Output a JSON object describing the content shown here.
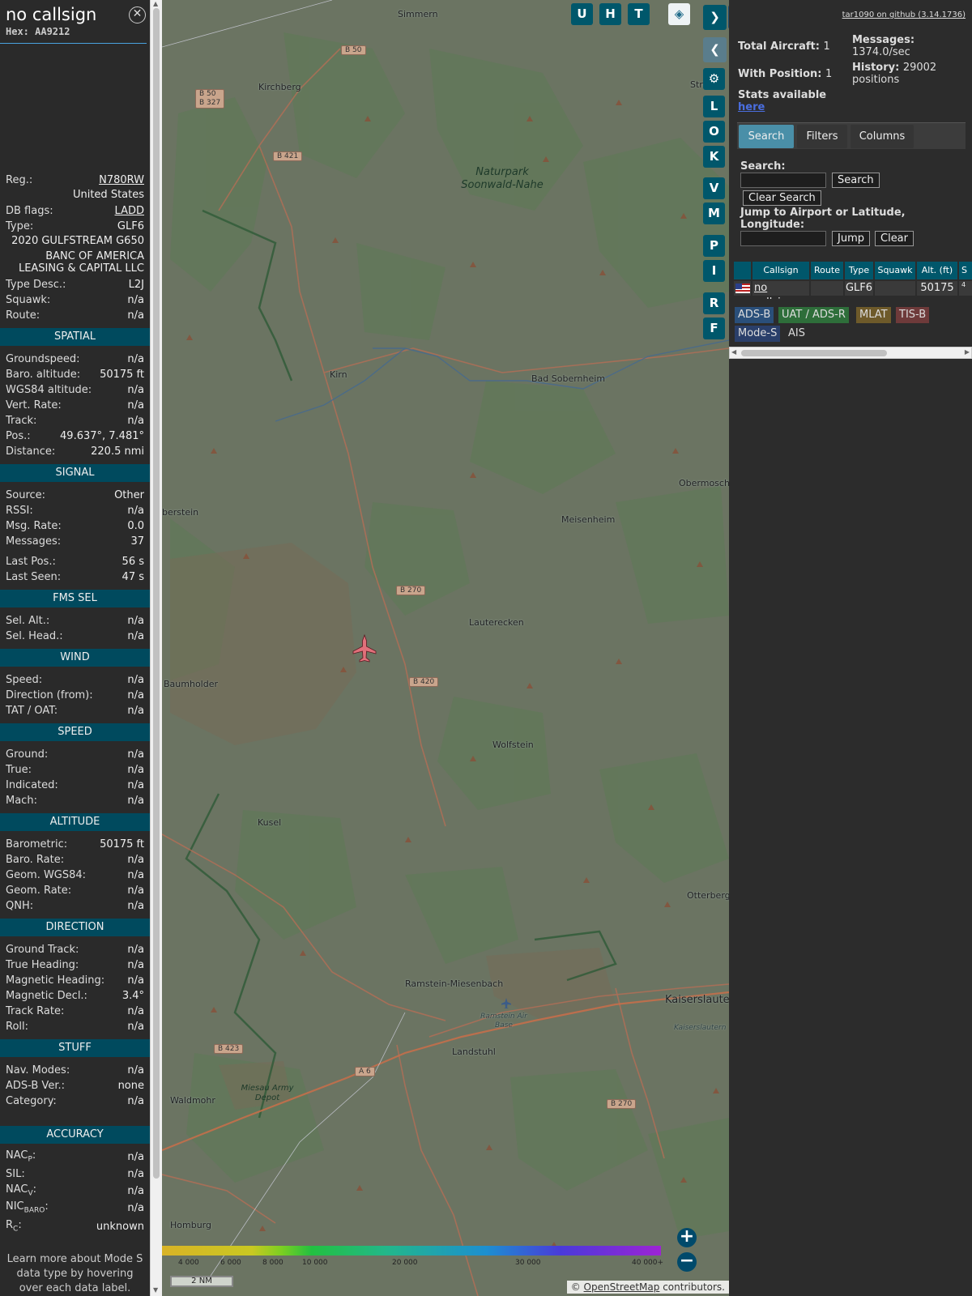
{
  "infoblock": {
    "title": "no callsign",
    "hex": "Hex: AA9212",
    "reg_label": "Reg.:",
    "reg_value": "N780RW",
    "country": "United States",
    "dbflags_label": "DB flags:",
    "dbflags_value": "LADD",
    "type_label": "Type:",
    "type_value": "GLF6",
    "model": "2020 GULFSTREAM G650",
    "owner": "BANC OF AMERICA LEASING & CAPITAL LLC",
    "typedesc_label": "Type Desc.:",
    "typedesc_value": "L2J",
    "squawk_label": "Squawk:",
    "squawk_value": "n/a",
    "route_label": "Route:",
    "route_value": "n/a",
    "spatial": {
      "header": "SPATIAL",
      "groundspeed": [
        "Groundspeed:",
        "n/a"
      ],
      "baro_alt": [
        "Baro. altitude:",
        "50175 ft"
      ],
      "wgs_alt": [
        "WGS84 altitude:",
        "n/a"
      ],
      "vert_rate": [
        "Vert. Rate:",
        "n/a"
      ],
      "track": [
        "Track:",
        "n/a"
      ],
      "pos": [
        "Pos.:",
        "49.637°, 7.481°"
      ],
      "distance": [
        "Distance:",
        "220.5 nmi"
      ]
    },
    "signal": {
      "header": "SIGNAL",
      "source": [
        "Source:",
        "Other"
      ],
      "rssi": [
        "RSSI:",
        "n/a"
      ],
      "msg_rate": [
        "Msg. Rate:",
        "0.0"
      ],
      "messages": [
        "Messages:",
        "37"
      ],
      "last_pos": [
        "Last Pos.:",
        "56 s"
      ],
      "last_seen": [
        "Last Seen:",
        "47 s"
      ]
    },
    "fms": {
      "header": "FMS SEL",
      "sel_alt": [
        "Sel. Alt.:",
        "n/a"
      ],
      "sel_head": [
        "Sel. Head.:",
        "n/a"
      ]
    },
    "wind": {
      "header": "WIND",
      "speed": [
        "Speed:",
        "n/a"
      ],
      "direction": [
        "Direction (from):",
        "n/a"
      ],
      "tat": [
        "TAT / OAT:",
        "n/a"
      ]
    },
    "speed": {
      "header": "SPEED",
      "ground": [
        "Ground:",
        "n/a"
      ],
      "true": [
        "True:",
        "n/a"
      ],
      "indicated": [
        "Indicated:",
        "n/a"
      ],
      "mach": [
        "Mach:",
        "n/a"
      ]
    },
    "altitude": {
      "header": "ALTITUDE",
      "barometric": [
        "Barometric:",
        "50175 ft"
      ],
      "baro_rate": [
        "Baro. Rate:",
        "n/a"
      ],
      "geom_wgs": [
        "Geom. WGS84:",
        "n/a"
      ],
      "geom_rate": [
        "Geom. Rate:",
        "n/a"
      ],
      "qnh": [
        "QNH:",
        "n/a"
      ]
    },
    "direction": {
      "header": "DIRECTION",
      "ground_track": [
        "Ground Track:",
        "n/a"
      ],
      "true_heading": [
        "True Heading:",
        "n/a"
      ],
      "mag_heading": [
        "Magnetic Heading:",
        "n/a"
      ],
      "mag_decl": [
        "Magnetic Decl.:",
        "3.4°"
      ],
      "track_rate": [
        "Track Rate:",
        "n/a"
      ],
      "roll": [
        "Roll:",
        "n/a"
      ]
    },
    "stuff": {
      "header": "STUFF",
      "nav_modes": [
        "Nav. Modes:",
        "n/a"
      ],
      "adsb_ver": [
        "ADS-B Ver.:",
        "none"
      ],
      "category": [
        "Category:",
        "n/a"
      ]
    },
    "accuracy": {
      "header": "ACCURACY",
      "nacp_label": "NAC",
      "nacp_sub": "P",
      "nacp_value": "n/a",
      "sil": [
        "SIL:",
        "n/a"
      ],
      "nacv_label": "NAC",
      "nacv_sub": "V",
      "nacv_value": "n/a",
      "nic_label": "NIC",
      "nic_sub": "BARO",
      "nic_value": "n/a",
      "rc_label": "R",
      "rc_sub": "C",
      "rc_value": "unknown"
    },
    "footer_note": "Learn more about Mode S data type by hovering over each data label."
  },
  "map": {
    "places": [
      "Simmern",
      "Kirchberg",
      "Kirn",
      "Bad Sobernheim",
      "Obermosch",
      "berstein",
      "Meisenheim",
      "Lauterecken",
      "Baumholder",
      "Wolfstein",
      "Kusel",
      "Otterberg",
      "Ramstein-Miesenbach",
      "Kaiserslaute",
      "Landstuhl",
      "Waldmohr",
      "Homburg",
      "Stro",
      "Kaiserslautern",
      "Ramstein Air Base"
    ],
    "roads": [
      "B 50",
      "B 50\nB 327",
      "B 421",
      "B 270",
      "B 420",
      "B 423",
      "A 6",
      "B 270"
    ],
    "nature": [
      "Naturpark Soonwald-Nahe",
      "Miesau Army Depot"
    ],
    "buttons": [
      "U",
      "H",
      "T",
      "L",
      "O",
      "K",
      "V",
      "M",
      "P",
      "I",
      "R",
      "F"
    ],
    "colorbar_ticks": [
      "4 000",
      "6 000",
      "8 000",
      "10 000",
      "20 000",
      "30 000",
      "40 000+"
    ],
    "scale": "2 NM",
    "attribution_prefix": "©",
    "attribution_link": "OpenStreetMap",
    "attribution_suffix": "contributors."
  },
  "sidebar": {
    "github_link": "tar1090 on github (3.14.1736)",
    "total_aircraft_label": "Total Aircraft:",
    "total_aircraft_value": "1",
    "with_position_label": "With Position:",
    "with_position_value": "1",
    "messages_label": "Messages:",
    "messages_value": "1374.0/sec",
    "history_label": "History:",
    "history_value": "29002 positions",
    "stats_label": "Stats available",
    "stats_link": "here",
    "tabs": [
      "Search",
      "Filters",
      "Columns"
    ],
    "search_label": "Search:",
    "search_button": "Search",
    "clear_search_button": "Clear Search",
    "jump_label": "Jump to Airport or Latitude, Longitude:",
    "jump_button": "Jump",
    "clear_button": "Clear",
    "table": {
      "headers": [
        "Callsign",
        "Route",
        "Type",
        "Squawk",
        "Alt. (ft)",
        "S"
      ],
      "row": {
        "callsign": "no callsign",
        "route": "",
        "type": "GLF6",
        "squawk": "",
        "alt": "50175",
        "extra": "4"
      }
    },
    "source_tags": [
      "ADS-B",
      "UAT / ADS-R",
      "MLAT",
      "TIS-B",
      "Mode-S",
      "AIS"
    ]
  },
  "colors": {
    "header_teal": "#004a5e",
    "button_teal": "#00576b",
    "aircraft": "#e0707a",
    "adsb": "#2a4f7a",
    "uat": "#2e6e3a",
    "mlat": "#6e5a2a",
    "tisb": "#6e3a3a"
  }
}
